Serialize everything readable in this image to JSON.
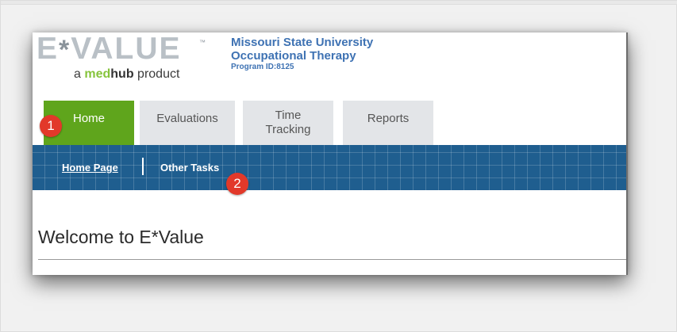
{
  "logo": {
    "brand_left": "E",
    "brand_star": "*",
    "brand_right": "VALUE",
    "trademark": "™",
    "tagline_prefix": "a",
    "medhub_med": "med",
    "medhub_hub": "hub",
    "tagline_suffix": "product"
  },
  "program": {
    "university": "Missouri State University",
    "department": "Occupational Therapy",
    "program_id": "Program ID:8125"
  },
  "tabs": [
    {
      "label": "Home",
      "active": true
    },
    {
      "label": "Evaluations",
      "active": false
    },
    {
      "label": "Time Tracking",
      "active": false
    },
    {
      "label": "Reports",
      "active": false
    }
  ],
  "subnav": {
    "home_page": "Home Page",
    "other_tasks": "Other Tasks"
  },
  "main": {
    "welcome": "Welcome to E*Value"
  },
  "annotations": {
    "marker_1": "1",
    "marker_2": "2"
  },
  "colors": {
    "active_tab": "#5fa51c",
    "subnav_bar": "#1f5e8f",
    "program_text": "#3e72b3",
    "annotation_marker": "#e2392a"
  }
}
